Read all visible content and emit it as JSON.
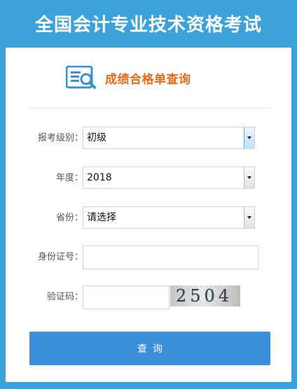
{
  "header": {
    "title": "全国会计专业技术资格考试"
  },
  "card": {
    "title": "成绩合格单查询",
    "icon": "document-search-icon"
  },
  "form": {
    "exam_level": {
      "label": "报考级别：",
      "value": "初级"
    },
    "year": {
      "label": "年度：",
      "value": "2018"
    },
    "province": {
      "label": "省份：",
      "value": "请选择"
    },
    "id_number": {
      "label": "身份证号：",
      "value": "",
      "placeholder": ""
    },
    "captcha_input": {
      "label": "验证码：",
      "value": "",
      "placeholder": ""
    },
    "captcha_image": {
      "text": "2504"
    },
    "submit_label": "查询"
  },
  "colors": {
    "page_background": "#3ea2da",
    "card_title": "#e86b1d",
    "button": "#3b8fd9",
    "icon": "#3d8fd0"
  }
}
